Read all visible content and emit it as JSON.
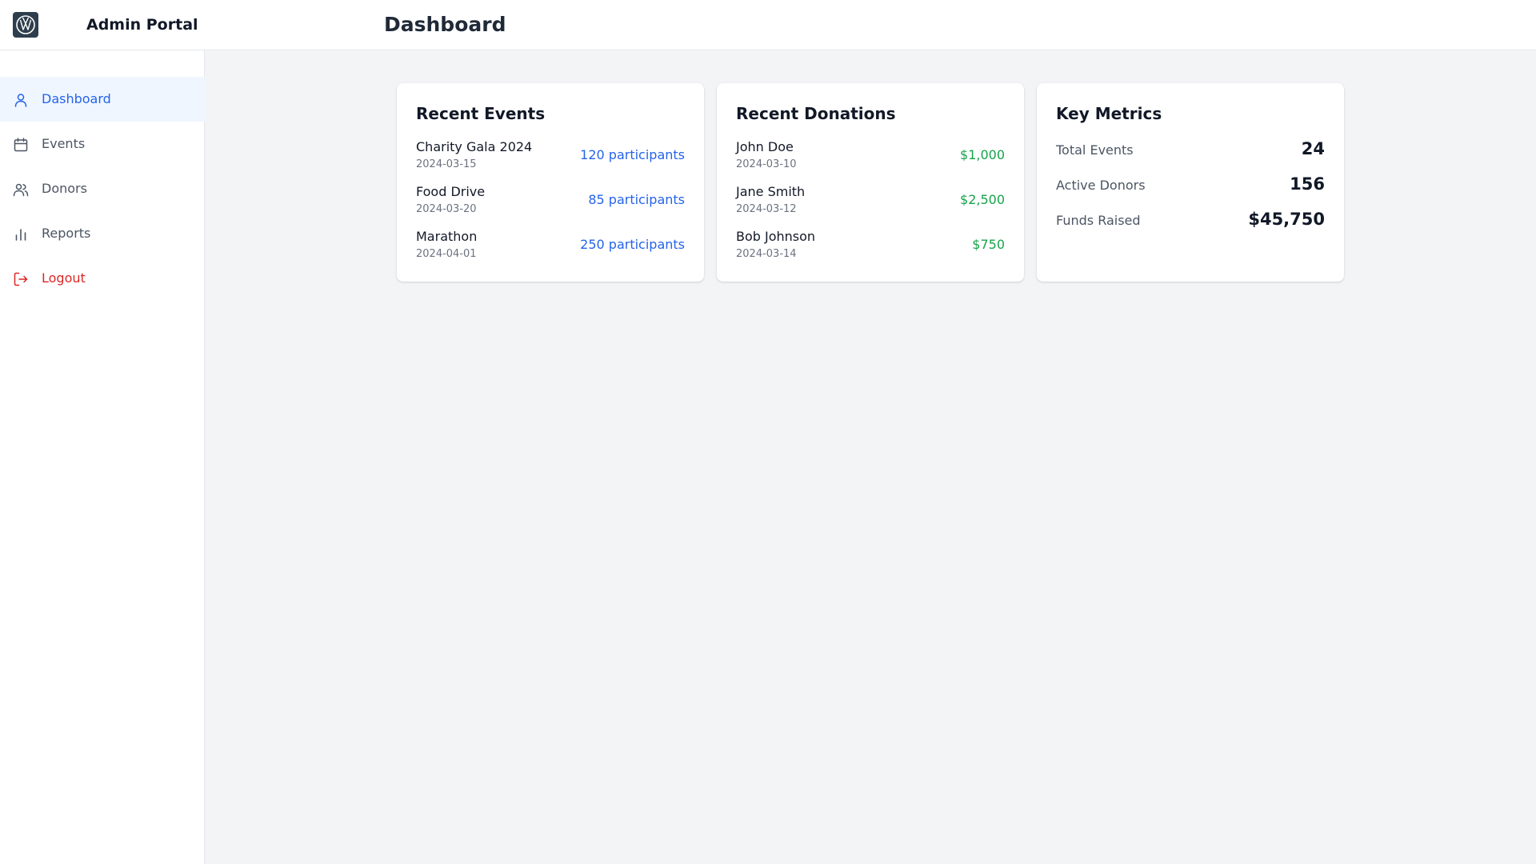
{
  "header": {
    "app_title": "Admin Portal",
    "page_title": "Dashboard",
    "logo_icon": "vw-logo"
  },
  "sidebar": {
    "items": [
      {
        "label": "Dashboard",
        "icon": "user-icon",
        "active": true
      },
      {
        "label": "Events",
        "icon": "calendar-icon",
        "active": false
      },
      {
        "label": "Donors",
        "icon": "users-icon",
        "active": false
      },
      {
        "label": "Reports",
        "icon": "bar-chart-icon",
        "active": false
      },
      {
        "label": "Logout",
        "icon": "logout-icon",
        "active": false
      }
    ]
  },
  "recent_events": {
    "title": "Recent Events",
    "items": [
      {
        "name": "Charity Gala 2024",
        "date": "2024-03-15",
        "participants": "120 participants"
      },
      {
        "name": "Food Drive",
        "date": "2024-03-20",
        "participants": "85 participants"
      },
      {
        "name": "Marathon",
        "date": "2024-04-01",
        "participants": "250 participants"
      }
    ]
  },
  "recent_donations": {
    "title": "Recent Donations",
    "items": [
      {
        "name": "John Doe",
        "date": "2024-03-10",
        "amount": "$1,000"
      },
      {
        "name": "Jane Smith",
        "date": "2024-03-12",
        "amount": "$2,500"
      },
      {
        "name": "Bob Johnson",
        "date": "2024-03-14",
        "amount": "$750"
      }
    ]
  },
  "key_metrics": {
    "title": "Key Metrics",
    "items": [
      {
        "label": "Total Events",
        "value": "24"
      },
      {
        "label": "Active Donors",
        "value": "156"
      },
      {
        "label": "Funds Raised",
        "value": "$45,750"
      }
    ]
  },
  "colors": {
    "accent_blue": "#2563eb",
    "success_green": "#16a34a",
    "danger_red": "#dc2626",
    "active_bg": "#eff6ff",
    "page_bg": "#f3f4f6"
  }
}
